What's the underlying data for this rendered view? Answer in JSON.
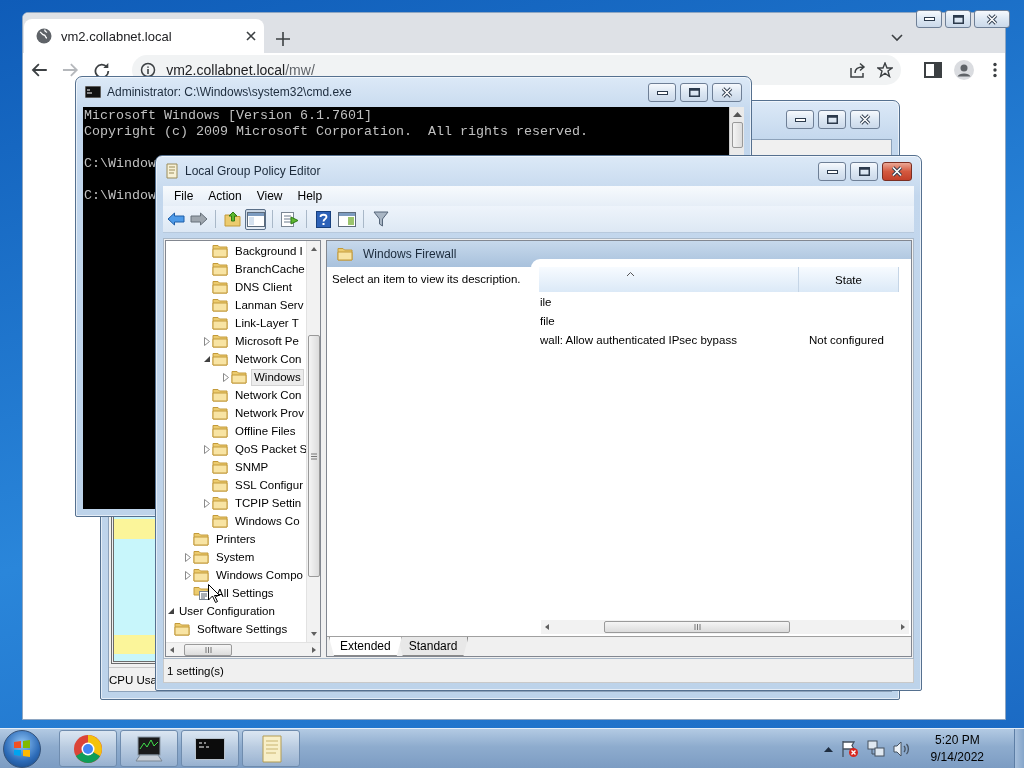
{
  "browser": {
    "tab_title": "vm2.collabnet.local",
    "url_host": "vm2.collabnet.local",
    "url_path": "/mw/"
  },
  "task_manager": {
    "status": "CPU Usa"
  },
  "cmd": {
    "title": "Administrator: C:\\Windows\\system32\\cmd.exe",
    "lines": [
      {
        "kind": "output",
        "text": "Microsoft Windows [Version 6.1.7601]"
      },
      {
        "kind": "output",
        "text": "Copyright (c) 2009 Microsoft Corporation.  All rights reserved."
      },
      {
        "kind": "prompt",
        "text": "C:\\Window"
      },
      {
        "kind": "prompt",
        "text": "C:\\Window"
      }
    ]
  },
  "policy_editor": {
    "title": "Local Group Policy Editor",
    "menu": [
      "File",
      "Action",
      "View",
      "Help"
    ],
    "toolbar": [
      {
        "kind": "back",
        "pressed": false
      },
      {
        "kind": "forward",
        "pressed": false
      },
      {
        "kind": "up",
        "pressed": false
      },
      {
        "kind": "tree",
        "pressed": true
      },
      {
        "kind": "export",
        "pressed": false
      },
      {
        "kind": "help",
        "pressed": false
      },
      {
        "kind": "properties",
        "pressed": false
      },
      {
        "kind": "filter",
        "pressed": false
      }
    ],
    "tree": [
      {
        "children": [
          {
            "children": [
              {
                "children": [
                  {
                    "label": "Background I",
                    "kind": "folder",
                    "expandable": false,
                    "selected": false
                  },
                  {
                    "label": "BranchCache",
                    "kind": "folder",
                    "expandable": false,
                    "selected": false
                  },
                  {
                    "label": "DNS Client",
                    "kind": "folder",
                    "expandable": false,
                    "selected": false
                  },
                  {
                    "label": "Lanman Serv",
                    "kind": "folder",
                    "expandable": false,
                    "selected": false
                  },
                  {
                    "label": "Link-Layer T",
                    "kind": "folder",
                    "expandable": false,
                    "selected": false
                  },
                  {
                    "label": "Microsoft Pe",
                    "kind": "folder",
                    "expandable": true,
                    "expanded": false,
                    "selected": false
                  },
                  {
                    "label": "Network Con",
                    "kind": "folder",
                    "expandable": true,
                    "expanded": true,
                    "selected": false,
                    "children": [
                      {
                        "label": "Windows",
                        "kind": "folder",
                        "expandable": true,
                        "expanded": false,
                        "selected": true
                      }
                    ]
                  },
                  {
                    "label": "Network Con",
                    "kind": "folder",
                    "expandable": false,
                    "selected": false
                  },
                  {
                    "label": "Network Prov",
                    "kind": "folder",
                    "expandable": false,
                    "selected": false
                  },
                  {
                    "label": "Offline Files",
                    "kind": "folder",
                    "expandable": false,
                    "selected": false
                  },
                  {
                    "label": "QoS Packet S",
                    "kind": "folder",
                    "expandable": true,
                    "expanded": false,
                    "selected": false
                  },
                  {
                    "label": "SNMP",
                    "kind": "folder",
                    "expandable": false,
                    "selected": false
                  },
                  {
                    "label": "SSL Configur",
                    "kind": "folder",
                    "expandable": false,
                    "selected": false
                  },
                  {
                    "label": "TCPIP Settin",
                    "kind": "folder",
                    "expandable": true,
                    "expanded": false,
                    "selected": false
                  },
                  {
                    "label": "Windows Co",
                    "kind": "folder",
                    "expandable": false,
                    "selected": false
                  }
                ]
              },
              {
                "label": "Printers",
                "kind": "folder",
                "expandable": false,
                "selected": false
              },
              {
                "label": "System",
                "kind": "folder",
                "expandable": true,
                "expanded": false,
                "selected": false
              },
              {
                "label": "Windows Compo",
                "kind": "folder",
                "expandable": true,
                "expanded": false,
                "selected": false
              },
              {
                "label": "All Settings",
                "kind": "settings",
                "expandable": false,
                "selected": false
              }
            ]
          }
        ]
      },
      {
        "label": "User Configuration",
        "expandable": true,
        "expanded": true,
        "selected": false,
        "children": [
          {
            "label": "Software Settings",
            "kind": "folder",
            "expandable": false,
            "selected": false
          }
        ]
      }
    ],
    "header": "Windows Firewall",
    "description": "Select an item to view its description.",
    "columns": [
      {
        "sorted": true
      },
      {
        "label": "State",
        "sorted": false
      }
    ],
    "rows": [
      {
        "setting": "ile"
      },
      {
        "setting": "file"
      },
      {
        "setting": "wall: Allow authenticated IPsec bypass",
        "state": "Not configured"
      }
    ],
    "tabs": [
      {
        "label": "Extended",
        "selected": true
      },
      {
        "label": "Standard",
        "selected": false
      }
    ],
    "status": "1 setting(s)"
  },
  "taskbar": {
    "apps": [
      {
        "kind": "chrome"
      },
      {
        "kind": "taskmgr"
      },
      {
        "kind": "cmd"
      },
      {
        "kind": "gpedit"
      }
    ],
    "time": "5:20 PM",
    "date": "9/14/2022"
  }
}
